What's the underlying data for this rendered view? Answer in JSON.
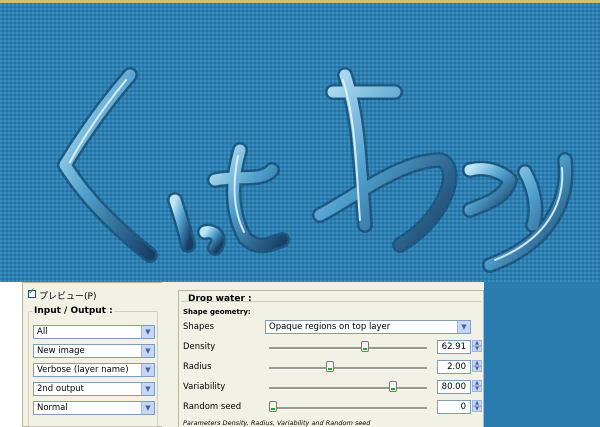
{
  "preview": {
    "label": "プレビュー(P)",
    "checked": true
  },
  "io": {
    "title": "Input / Output :",
    "selects": [
      {
        "name": "input-layers-select",
        "value": "All"
      },
      {
        "name": "output-mode-select",
        "value": "New image"
      },
      {
        "name": "output-layer-name-select",
        "value": "Verbose (layer name)"
      },
      {
        "name": "preview-output-select",
        "value": "2nd output"
      },
      {
        "name": "output-blend-select",
        "value": "Normal"
      }
    ]
  },
  "filter": {
    "title": "Drop water :",
    "section": "Shape geometry:",
    "shapes_label": "Shapes",
    "shapes_value": "Opaque regions on top layer",
    "params": [
      {
        "label": "Density",
        "value": "62.91",
        "fraction": 0.61
      },
      {
        "label": "Radius",
        "value": "2.00",
        "fraction": 0.38
      },
      {
        "label": "Variability",
        "value": "80.00",
        "fraction": 0.8
      },
      {
        "label": "Random seed",
        "value": "0",
        "fraction": 0.0
      }
    ],
    "footer": "Parameters Density, Radius, Variability and Random seed"
  },
  "colors": {
    "water": "#2b7cae",
    "panel": "#f2f1e6",
    "accent": "#1fae35"
  }
}
